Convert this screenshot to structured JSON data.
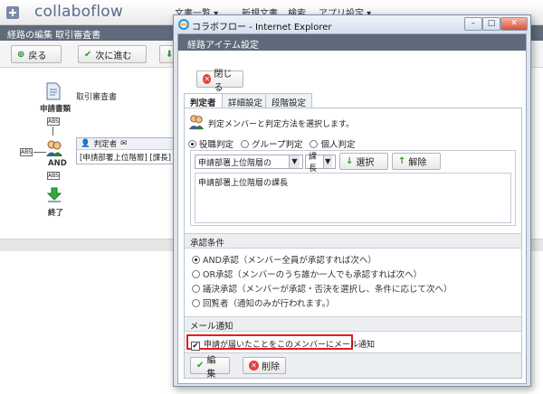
{
  "app": {
    "logo_text": "collaboflow",
    "nav": [
      "文書一覧 ▾",
      "新規文書",
      "検索",
      "アプリ設定 ▾"
    ],
    "subheader": "経路の編集 取引審査書",
    "toolbar": {
      "back": "戻る",
      "next": "次に進む"
    },
    "route": {
      "applicant_label": "申請書類",
      "doc_name": "取引審査書",
      "and_label": "AND",
      "end_label": "終了",
      "arrow_tag": "ABS",
      "approver_header": "判定者",
      "approver_value": "[申請部署上位階層] [課長]"
    }
  },
  "dialog": {
    "title": "コラボフロー - Internet Explorer",
    "inner_title": "経路アイテム設定",
    "close_button": "閉じる",
    "tabs": [
      "判定者",
      "詳細設定",
      "段階設定"
    ],
    "description": "判定メンバーと判定方法を選択します。",
    "judge_modes": [
      {
        "label": "役職判定",
        "selected": true
      },
      {
        "label": "グループ判定",
        "selected": false
      },
      {
        "label": "個人判定",
        "selected": false
      }
    ],
    "dept_select": "申請部署上位階層の",
    "role_select": "課長",
    "select_button": "選択",
    "remove_button": "解除",
    "selected_members": [
      "申請部署上位階層の課長"
    ],
    "approval_section": "承認条件",
    "approval_options": [
      {
        "label": "AND承認（メンバー全員が承認すれば次へ）",
        "selected": true
      },
      {
        "label": "OR承認（メンバーのうち誰か一人でも承認すれば次へ）",
        "selected": false
      },
      {
        "label": "議決承認（メンバーが承認・否決を選択し、条件に応じて次へ）",
        "selected": false
      },
      {
        "label": "回覧者（通知のみが行われます。）",
        "selected": false
      }
    ],
    "mail_section": "メール通知",
    "mail_checkbox": "申請が届いたことをこのメンバーにメール通知",
    "edit_button": "編集",
    "delete_button": "削除"
  },
  "colors": {
    "highlight": "#e02020",
    "header_bar": "#5f6a7a",
    "accent_green": "#2e9a2e"
  }
}
